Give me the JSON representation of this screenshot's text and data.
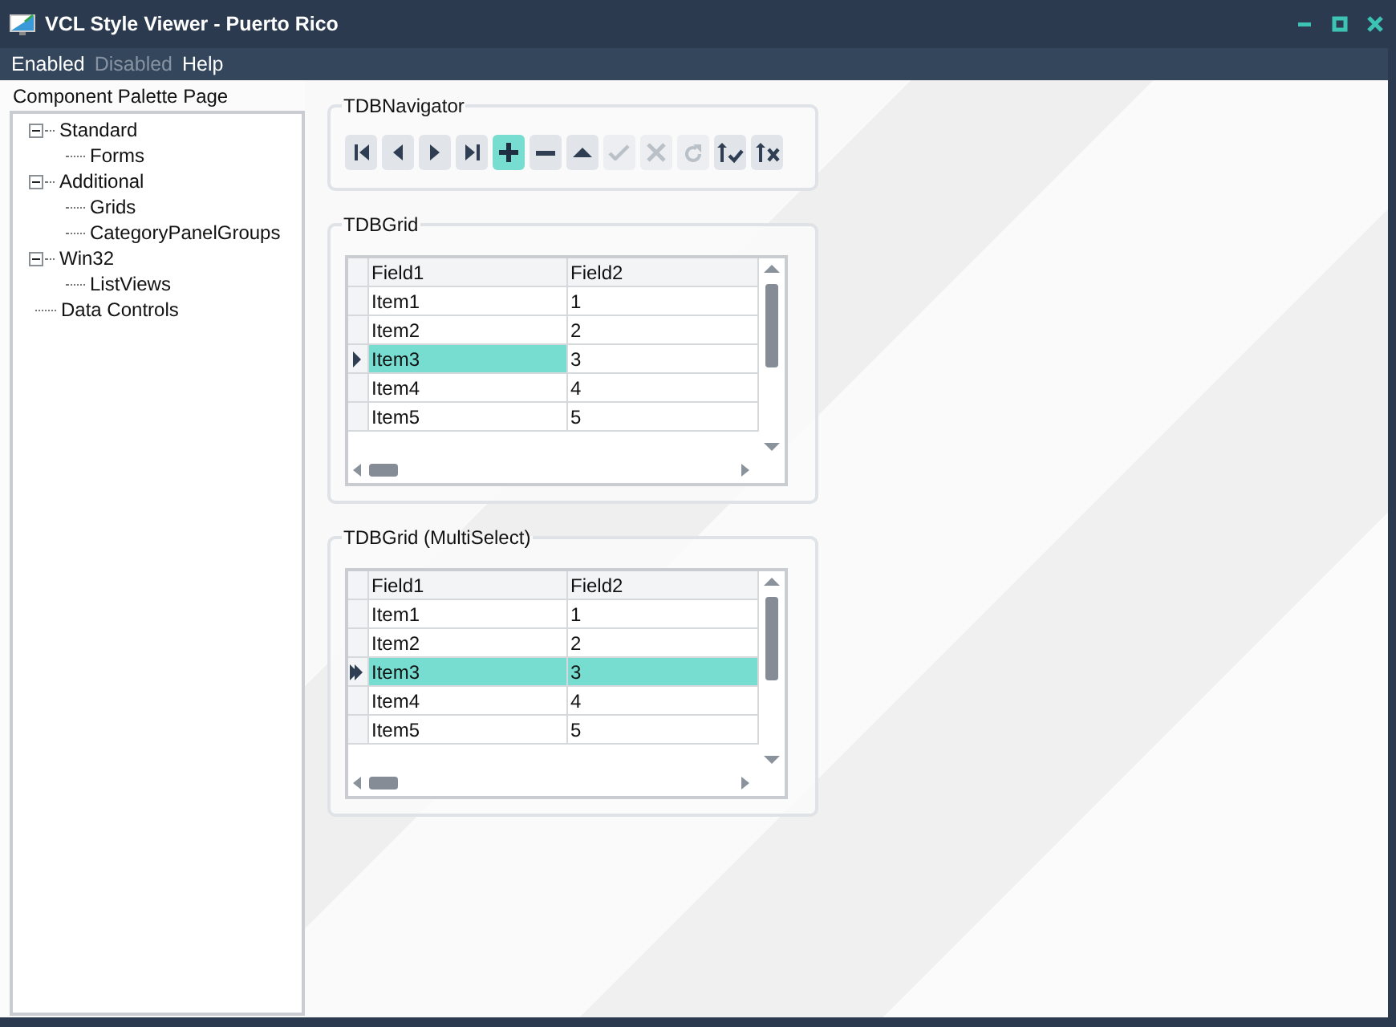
{
  "window": {
    "title": "VCL Style Viewer - Puerto Rico"
  },
  "menu": [
    {
      "label": "Enabled",
      "disabled": false
    },
    {
      "label": "Disabled",
      "disabled": true
    },
    {
      "label": "Help",
      "disabled": false
    }
  ],
  "palette": {
    "title": "Component Palette Page",
    "tree": [
      {
        "label": "Standard",
        "expanded": true,
        "children": [
          {
            "label": "Forms"
          }
        ]
      },
      {
        "label": "Additional",
        "expanded": true,
        "children": [
          {
            "label": "Grids"
          },
          {
            "label": "CategoryPanelGroups"
          }
        ]
      },
      {
        "label": "Win32",
        "expanded": true,
        "children": [
          {
            "label": "ListViews"
          }
        ]
      },
      {
        "label": "Data Controls"
      }
    ]
  },
  "navigator": {
    "title": "TDBNavigator",
    "buttons": [
      {
        "kind": "first",
        "disabled": false,
        "highlighted": false
      },
      {
        "kind": "prior",
        "disabled": false,
        "highlighted": false
      },
      {
        "kind": "next",
        "disabled": false,
        "highlighted": false
      },
      {
        "kind": "last",
        "disabled": false,
        "highlighted": false
      },
      {
        "kind": "insert",
        "disabled": false,
        "highlighted": true
      },
      {
        "kind": "delete",
        "disabled": false,
        "highlighted": false
      },
      {
        "kind": "edit",
        "disabled": false,
        "highlighted": false
      },
      {
        "kind": "post",
        "disabled": true,
        "highlighted": false
      },
      {
        "kind": "cancel",
        "disabled": true,
        "highlighted": false
      },
      {
        "kind": "refresh",
        "disabled": true,
        "highlighted": false
      },
      {
        "kind": "apply",
        "disabled": false,
        "highlighted": false
      },
      {
        "kind": "discard",
        "disabled": false,
        "highlighted": false
      }
    ]
  },
  "grids": [
    {
      "title": "TDBGrid",
      "multiselect": false,
      "columns": [
        "Field1",
        "Field2"
      ],
      "rows": [
        {
          "cells": [
            "Item1",
            "1"
          ],
          "current": false,
          "selected": false
        },
        {
          "cells": [
            "Item2",
            "2"
          ],
          "current": false,
          "selected": false
        },
        {
          "cells": [
            "Item3",
            "3"
          ],
          "current": true,
          "selected": false
        },
        {
          "cells": [
            "Item4",
            "4"
          ],
          "current": false,
          "selected": false
        },
        {
          "cells": [
            "Item5",
            "5"
          ],
          "current": false,
          "selected": false
        }
      ]
    },
    {
      "title": "TDBGrid (MultiSelect)",
      "multiselect": true,
      "columns": [
        "Field1",
        "Field2"
      ],
      "rows": [
        {
          "cells": [
            "Item1",
            "1"
          ],
          "current": false,
          "selected": false
        },
        {
          "cells": [
            "Item2",
            "2"
          ],
          "current": false,
          "selected": false
        },
        {
          "cells": [
            "Item3",
            "3"
          ],
          "current": true,
          "selected": true
        },
        {
          "cells": [
            "Item4",
            "4"
          ],
          "current": false,
          "selected": false
        },
        {
          "cells": [
            "Item5",
            "5"
          ],
          "current": false,
          "selected": false
        }
      ]
    }
  ]
}
